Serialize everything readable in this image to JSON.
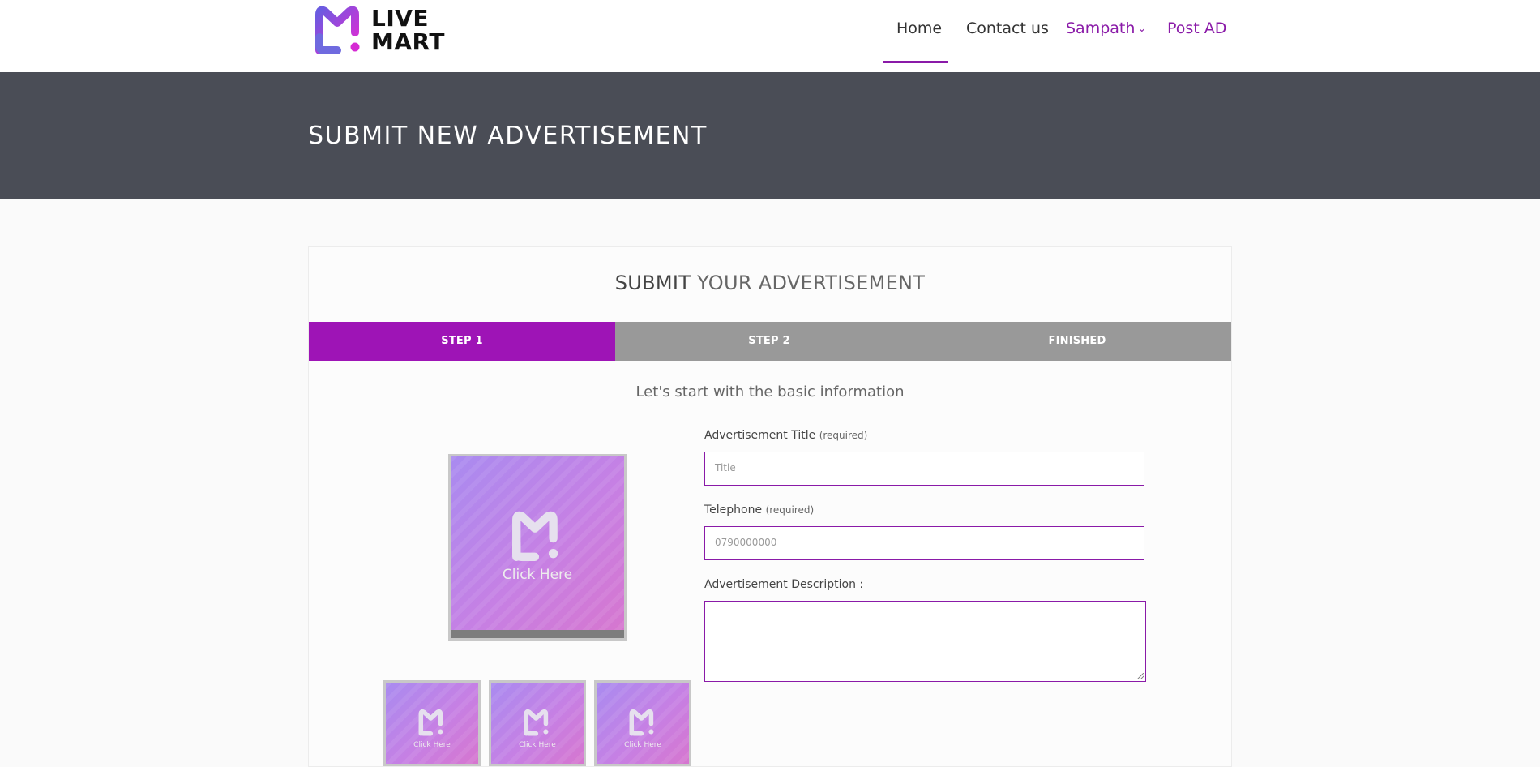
{
  "brand": {
    "logo_line1": "LIVE",
    "logo_line2": "MART",
    "accent": "#8a1aa8",
    "step_active": "#9e14b6"
  },
  "nav": {
    "home": "Home",
    "contact": "Contact us",
    "user": "Sampath",
    "post_ad": "Post AD"
  },
  "banner": {
    "title": "SUBMIT NEW ADVERTISEMENT"
  },
  "card": {
    "title_bold": "SUBMIT",
    "title_rest": " YOUR ADVERTISEMENT",
    "steps": [
      {
        "label": "STEP 1"
      },
      {
        "label": "STEP 2"
      },
      {
        "label": "FINISHED"
      }
    ],
    "active_step": 0,
    "intro": "Let's start with the basic information"
  },
  "images": {
    "main_label": "Click Here",
    "thumb_label": "Click Here"
  },
  "form": {
    "title_label": "Advertisement Title",
    "title_req": "(required)",
    "title_placeholder": "Title",
    "phone_label": "Telephone",
    "phone_req": "(required)",
    "phone_placeholder": "0790000000",
    "desc_label": "Advertisement Description :"
  }
}
